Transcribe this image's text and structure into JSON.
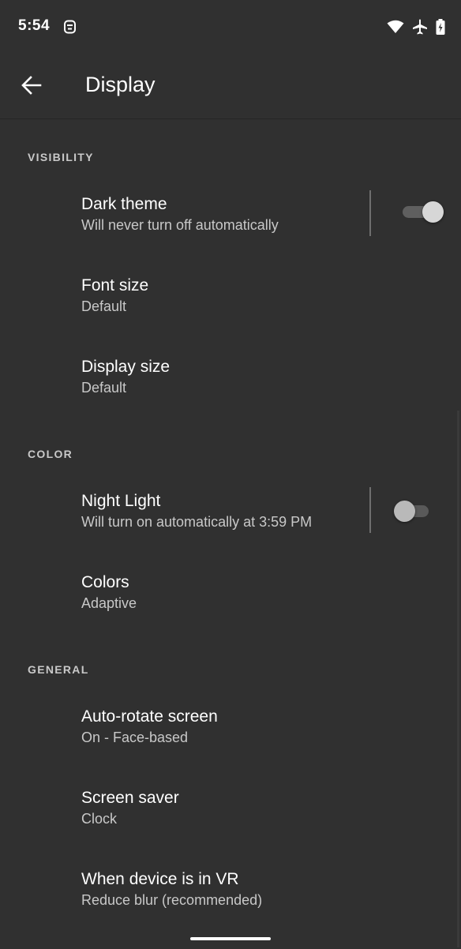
{
  "status_bar": {
    "time": "5:54",
    "icons": [
      "notification-icon",
      "wifi-icon",
      "airplane-icon",
      "battery-charging-icon"
    ]
  },
  "app_bar": {
    "title": "Display",
    "back_icon": "arrow-back-icon"
  },
  "sections": [
    {
      "header": "VISIBILITY",
      "items": [
        {
          "title": "Dark theme",
          "summary": "Will never turn off automatically",
          "switch": true
        },
        {
          "title": "Font size",
          "summary": "Default"
        },
        {
          "title": "Display size",
          "summary": "Default"
        }
      ]
    },
    {
      "header": "COLOR",
      "items": [
        {
          "title": "Night Light",
          "summary": "Will turn on automatically at 3:59 PM",
          "switch": false
        },
        {
          "title": "Colors",
          "summary": "Adaptive"
        }
      ]
    },
    {
      "header": "GENERAL",
      "items": [
        {
          "title": "Auto-rotate screen",
          "summary": "On - Face-based"
        },
        {
          "title": "Screen saver",
          "summary": "Clock"
        },
        {
          "title": "When device is in VR",
          "summary": "Reduce blur (recommended)"
        }
      ]
    }
  ],
  "colors": {
    "background": "#303030",
    "text_primary": "#ffffff",
    "text_secondary": "#c8c8c8",
    "section_header": "#c9c9c9"
  }
}
